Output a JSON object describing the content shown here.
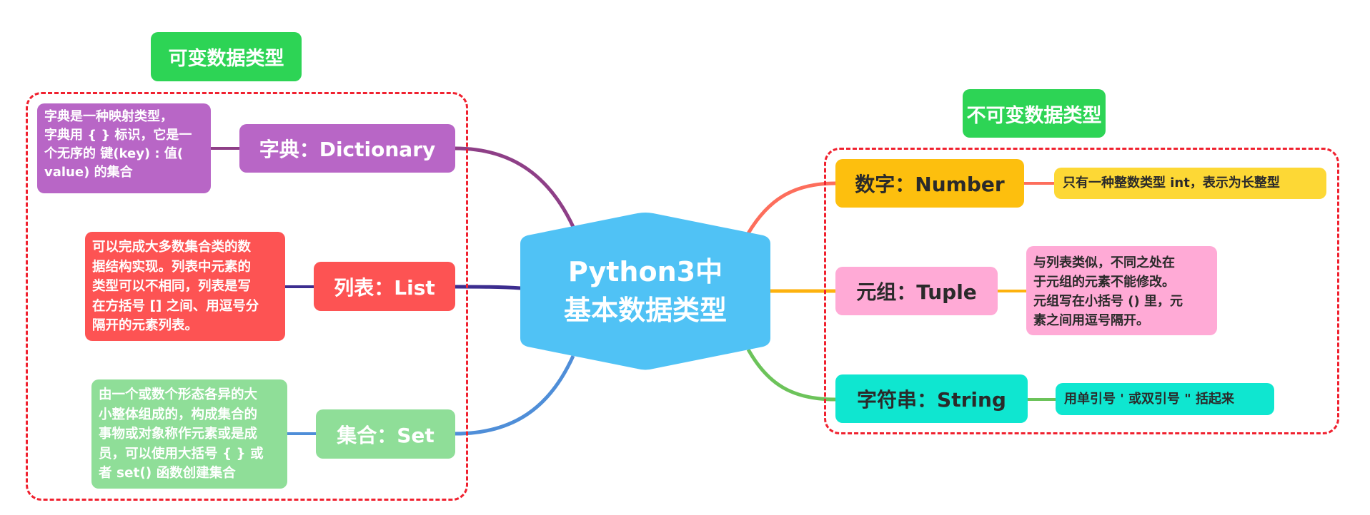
{
  "center": {
    "line1": "Python3中",
    "line2": "基本数据类型",
    "color": "#50c2f5"
  },
  "groups": {
    "mutable": {
      "label": "可变数据类型",
      "frame_color": "#f0212f",
      "label_color": "#2dd455"
    },
    "immutable": {
      "label": "不可变数据类型",
      "frame_color": "#f0212f",
      "label_color": "#2dd455"
    }
  },
  "branches": {
    "dictionary": {
      "label": "字典：Dictionary",
      "color": "#b866c6",
      "link_color": "#8e3f87",
      "desc_lines": [
        "字典是一种映射类型，",
        "字典用 { } 标识，它是一",
        "个无序的 键(key) : 值(",
        "value) 的集合"
      ]
    },
    "list": {
      "label": "列表：List",
      "color": "#fd5353",
      "link_color": "#3c2d8f",
      "desc_lines": [
        " 可以完成大多数集合类的数",
        "据结构实现。列表中元素的",
        "类型可以不相同，列表是写",
        "在方括号 [] 之间、用逗号分",
        "隔开的元素列表。"
      ]
    },
    "set": {
      "label": "集合：Set",
      "color": "#8fde98",
      "link_color": "#4f8ed8",
      "desc_lines": [
        "由一个或数个形态各异的大",
        "小整体组成的，构成集合的",
        "事物或对象称作元素或是成",
        "员，可以使用大括号 { } 或",
        "者 set() 函数创建集合"
      ]
    },
    "number": {
      "label": "数字：Number",
      "color": "#fdbf0e",
      "desc_color": "#fdd835",
      "link_color": "#fd6e5c",
      "desc_lines": [
        "只有一种整数类型 int，表示为长整型"
      ]
    },
    "tuple": {
      "label": "元组：Tuple",
      "color": "#ffaad6",
      "link_color": "#fdb20e",
      "desc_lines": [
        "与列表类似，不同之处在",
        "于元组的元素不能修改。",
        "元组写在小括号 () 里，元",
        "素之间用逗号隔开。"
      ]
    },
    "string": {
      "label": "字符串：String",
      "color": "#0fe6d0",
      "link_color": "#6cc35a",
      "desc_lines": [
        "用单引号 ' 或双引号 \" 括起来"
      ]
    }
  }
}
